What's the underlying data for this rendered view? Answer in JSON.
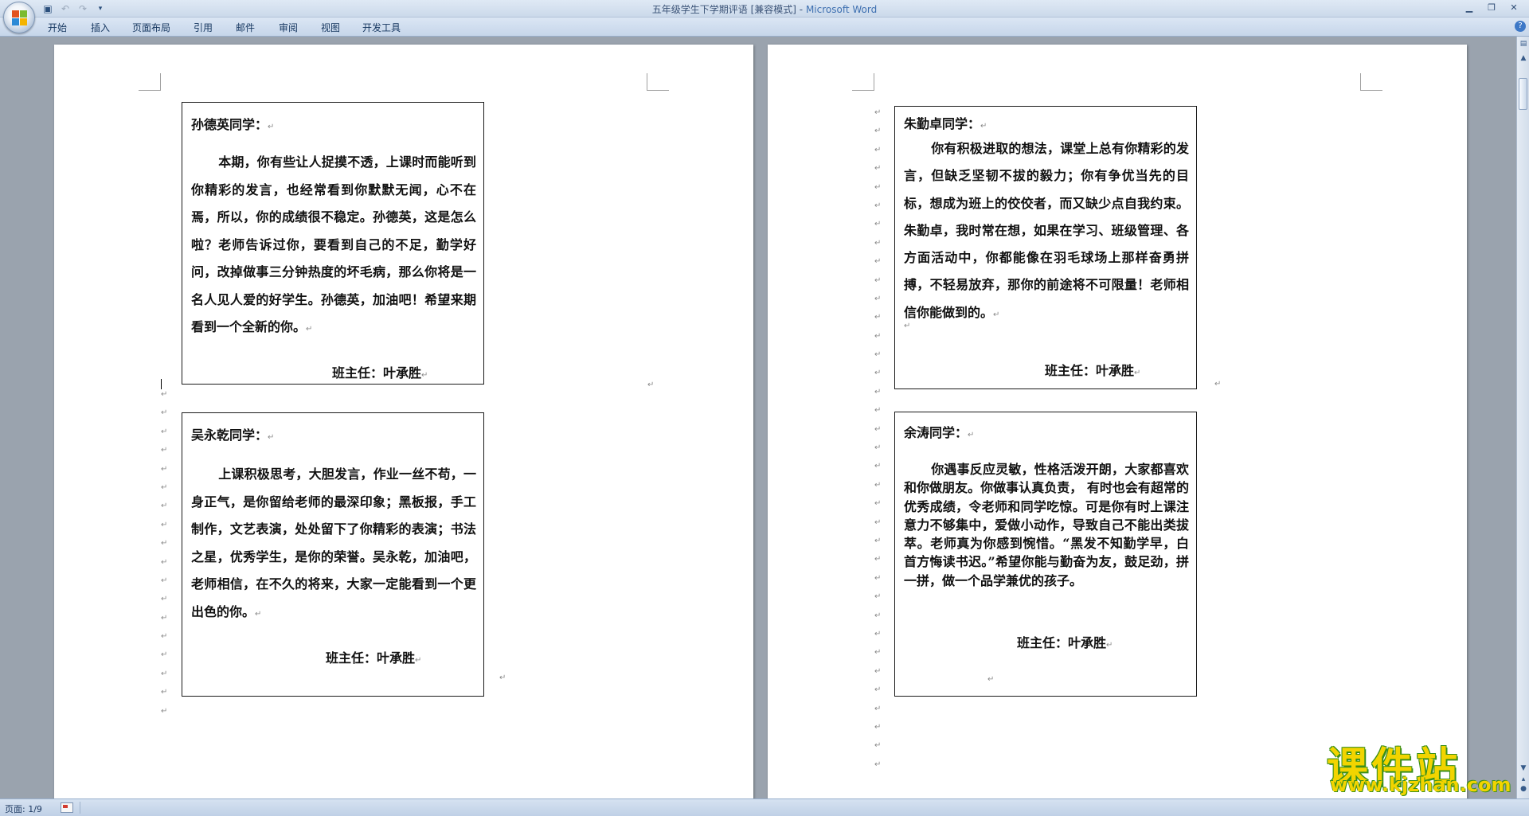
{
  "window": {
    "title": "五年级学生下学期评语 [兼容模式]",
    "title_sep": " - ",
    "app_name": "Microsoft Word"
  },
  "ribbon": {
    "tabs": [
      "开始",
      "插入",
      "页面布局",
      "引用",
      "邮件",
      "审阅",
      "视图",
      "开发工具"
    ]
  },
  "marks": {
    "paragraph": "↵",
    "return": "↵"
  },
  "cards": [
    {
      "heading": "孙德英同学：",
      "body": "本期，你有些让人捉摸不透，上课时而能听到你精彩的发言，也经常看到你默默无闻，心不在焉，所以，你的成绩很不稳定。孙德英，这是怎么啦？老师告诉过你，要看到自己的不足，勤学好问，改掉做事三分钟热度的坏毛病，那么你将是一名人见人爱的好学生。孙德英，加油吧！希望来期看到一个全新的你。",
      "signature": "班主任：叶承胜"
    },
    {
      "heading": "吴永乾同学：",
      "body": "上课积极思考，大胆发言，作业一丝不苟，一身正气，是你留给老师的最深印象；黑板报，手工制作，文艺表演，处处留下了你精彩的表演；书法之星，优秀学生，是你的荣誉。吴永乾，加油吧，老师相信，在不久的将来，大家一定能看到一个更出色的你。",
      "signature": "班主任：叶承胜"
    },
    {
      "heading": "朱勤卓同学：",
      "body": "你有积极进取的想法，课堂上总有你精彩的发言，但缺乏坚韧不拔的毅力；你有争优当先的目标，想成为班上的佼佼者，而又缺少点自我约束。朱勤卓，我时常在想，如果在学习、班级管理、各方面活动中，你都能像在羽毛球场上那样奋勇拼搏，不轻易放弃，那你的前途将不可限量！老师相信你能做到的。",
      "signature": "班主任：叶承胜"
    },
    {
      "heading": "余涛同学：",
      "body": "你遇事反应灵敏，性格活泼开朗，大家都喜欢和你做朋友。你做事认真负责， 有时也会有超常的优秀成绩，令老师和同学吃惊。可是你有时上课注意力不够集中，爱做小动作，导致自己不能出类拔萃。老师真为你感到惋惜。“黑发不知勤学早，白首方悔读书迟。”希望你能与勤奋为友，鼓足劲，拼一拼，做一个品学兼优的孩子。",
      "signature": "班主任：叶承胜"
    }
  ],
  "status": {
    "page": "页面: 1/9"
  },
  "watermark": {
    "name": "课件站",
    "url": "www.kjzhan.com"
  },
  "colors": {
    "title_brand": "#3d6fb0",
    "workspace": "#9aa3ae",
    "watermark_fill": "#f2d400",
    "watermark_outline": "#3a8f1a"
  },
  "icons": [
    "office-button-icon",
    "save-icon",
    "undo-icon",
    "redo-icon",
    "customize-qat-icon",
    "minimize-icon",
    "maximize-icon",
    "close-icon",
    "help-icon",
    "language-icon"
  ]
}
